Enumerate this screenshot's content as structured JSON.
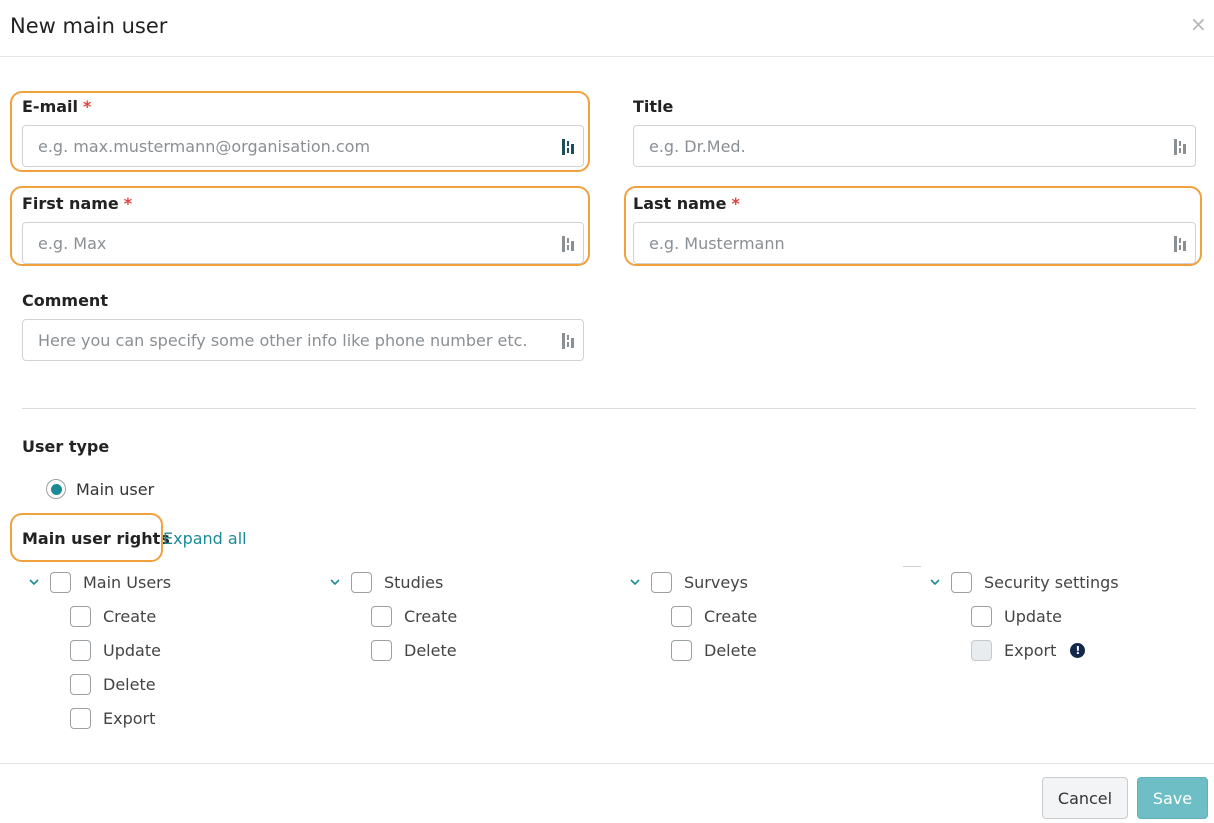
{
  "dialog": {
    "title": "New main user",
    "close_glyph": "×"
  },
  "form": {
    "email": {
      "label": "E-mail",
      "required_mark": "*",
      "placeholder": "e.g. max.mustermann@organisation.com",
      "value": ""
    },
    "title": {
      "label": "Title",
      "placeholder": "e.g. Dr.Med.",
      "value": ""
    },
    "first_name": {
      "label": "First name",
      "required_mark": "*",
      "placeholder": "e.g. Max",
      "value": ""
    },
    "last_name": {
      "label": "Last name",
      "required_mark": "*",
      "placeholder": "e.g. Mustermann",
      "value": ""
    },
    "comment": {
      "label": "Comment",
      "placeholder": "Here you can specify some other info like phone number etc.",
      "value": ""
    }
  },
  "user_type": {
    "label": "User type",
    "options": [
      {
        "label": "Main user",
        "selected": true
      }
    ]
  },
  "rights": {
    "label": "Main user rights",
    "expand_all": "Expand all",
    "groups": [
      {
        "label": "Main Users",
        "children": [
          "Create",
          "Update",
          "Delete",
          "Export"
        ]
      },
      {
        "label": "Studies",
        "children": [
          "Create",
          "Delete"
        ]
      },
      {
        "label": "Surveys",
        "children": [
          "Create",
          "Delete"
        ]
      },
      {
        "label": "Security settings",
        "children": [
          "Update",
          "Export"
        ]
      }
    ],
    "info_glyph": "!"
  },
  "footer": {
    "cancel_label": "Cancel",
    "save_label": "Save"
  },
  "colors": {
    "accent": "#1a8a97",
    "highlight": "#f0a03c",
    "required": "#e0413f",
    "save_button": "#6dbfc5",
    "info_icon": "#13294b"
  },
  "icons": {
    "field_addon": "keyboard-icon",
    "close": "close-icon",
    "tree_toggle": "chevron-down-icon",
    "export_info": "info-icon"
  }
}
